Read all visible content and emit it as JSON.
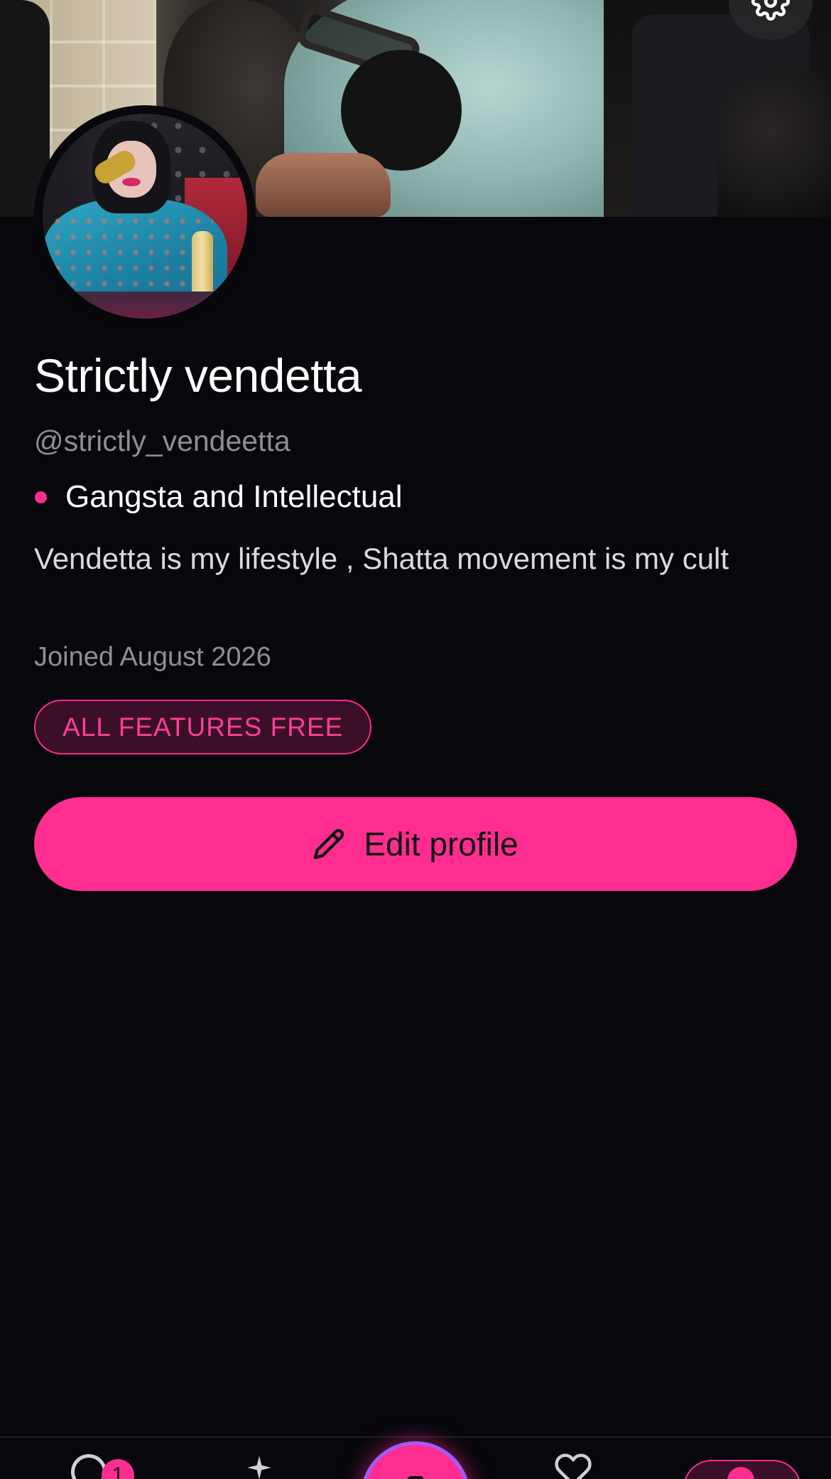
{
  "profile": {
    "display_name": "Strictly vendetta",
    "handle": "@strictly_vendeetta",
    "status": "Gangsta and Intellectual",
    "bio": "Vendetta is my lifestyle , Shatta movement is my cult",
    "joined": "Joined August 2026",
    "badge": "ALL FEATURES FREE"
  },
  "actions": {
    "edit_profile_label": "Edit profile"
  },
  "bottom_nav": {
    "notifications_count": "1",
    "items": [
      "home-icon",
      "sparkle-icon",
      "create-icon",
      "heart-icon",
      "profile-icon"
    ]
  },
  "colors": {
    "accent": "#ff2d8f",
    "background": "#07070c",
    "muted_text": "#8e8e96",
    "badge_bg": "#3a0f27"
  }
}
